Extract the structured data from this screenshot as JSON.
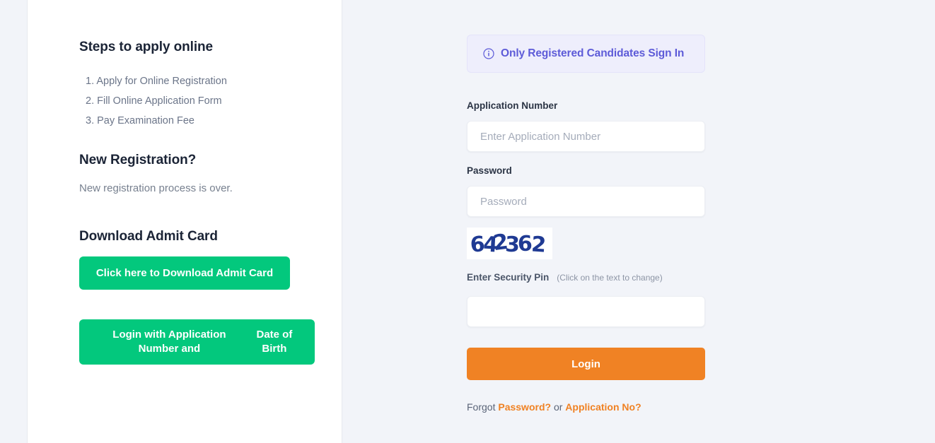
{
  "colors": {
    "page_background": "#f2f4f9",
    "panel_background": "#ffffff",
    "green_button": "#03c87d",
    "orange_button": "#f08224",
    "orange_link": "#f08224",
    "info_banner_background": "#eeeefc",
    "info_banner_text": "#5d5bd8",
    "captcha_digits": "#1f3a93"
  },
  "left": {
    "steps_heading": "Steps to apply online",
    "steps": [
      {
        "number": "1.",
        "label": "Apply for Online Registration"
      },
      {
        "number": "2.",
        "label": "Fill Online Application Form"
      },
      {
        "number": "3.",
        "label": "Pay Examination Fee"
      }
    ],
    "new_registration_heading": "New Registration?",
    "new_registration_text": "New registration process is over.",
    "download_admit_heading": "Download Admit Card",
    "download_admit_button": "Click here to Download Admit Card",
    "login_dob_button_line1": "Login with Application Number and",
    "login_dob_button_line2": "Date of Birth"
  },
  "form": {
    "info_banner": {
      "icon": "info-circle-icon",
      "text": "Only Registered Candidates Sign In"
    },
    "application_number": {
      "label": "Application Number",
      "placeholder": "Enter Application Number",
      "value": ""
    },
    "password": {
      "label": "Password",
      "placeholder": "Password",
      "value": ""
    },
    "captcha": {
      "code": "642362",
      "digits": [
        "6",
        "4",
        "2",
        "3",
        "6",
        "2"
      ]
    },
    "security_pin": {
      "label": "Enter Security Pin",
      "hint": "(Click on the text to change)",
      "placeholder": "",
      "value": ""
    },
    "login_button": "Login",
    "forgot": {
      "prefix": "Forgot",
      "password_link": "Password?",
      "separator": "or",
      "application_link": "Application No?"
    }
  }
}
